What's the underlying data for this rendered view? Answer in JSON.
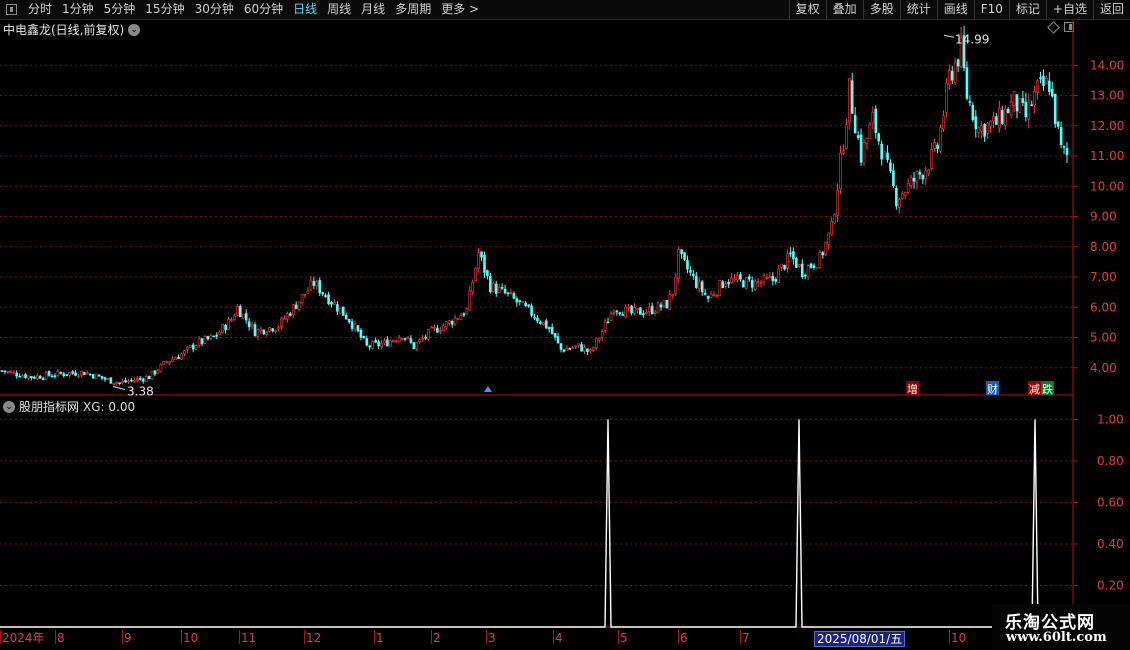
{
  "toolbar": {
    "left_items": [
      "分时",
      "1分钟",
      "5分钟",
      "15分钟",
      "30分钟",
      "60分钟",
      "日线",
      "周线",
      "月线",
      "多周期",
      "更多 >"
    ],
    "active": "日线",
    "right_items": [
      "复权",
      "叠加",
      "多股",
      "统计",
      "画线",
      "F10",
      "标记",
      "+自选",
      "返回"
    ]
  },
  "main": {
    "title": "中电鑫龙(日线,前复权)",
    "high_label": "14.99",
    "low_label": "3.38",
    "markers": [
      {
        "text": "增",
        "color": "#ffffff",
        "bg": "#8b0000"
      },
      {
        "text": "财",
        "color": "#ffffff",
        "bg": "#1e5aa8"
      },
      {
        "text": "减",
        "color": "#ffffff",
        "bg": "#a00000"
      },
      {
        "text": "跌",
        "color": "#ffffff",
        "bg": "#0a7a2a"
      }
    ]
  },
  "indicator": {
    "title": "股朋指标网",
    "value_label": "XG: 0.00"
  },
  "chart_data": [
    {
      "type": "candlestick",
      "title": "中电鑫龙(日线,前复权)",
      "y_ticks": [
        "14.00",
        "13.00",
        "12.00",
        "11.00",
        "10.00",
        "9.00",
        "8.00",
        "7.00",
        "6.00",
        "5.00",
        "4.00"
      ],
      "ylim": [
        3.1,
        15.0
      ],
      "high": 14.99,
      "low": 3.38,
      "close_path_anchors": [
        [
          0,
          3.9
        ],
        [
          10,
          3.7
        ],
        [
          20,
          3.8
        ],
        [
          28,
          3.85
        ],
        [
          36,
          3.6
        ],
        [
          40,
          3.5
        ],
        [
          50,
          3.7
        ],
        [
          56,
          4.2
        ],
        [
          62,
          4.5
        ],
        [
          66,
          4.8
        ],
        [
          72,
          5.0
        ],
        [
          78,
          5.6
        ],
        [
          80,
          6.0
        ],
        [
          86,
          5.2
        ],
        [
          94,
          5.4
        ],
        [
          100,
          6.1
        ],
        [
          106,
          6.8
        ],
        [
          110,
          6.4
        ],
        [
          118,
          5.6
        ],
        [
          124,
          4.7
        ],
        [
          130,
          4.8
        ],
        [
          136,
          5.1
        ],
        [
          140,
          4.7
        ],
        [
          146,
          5.2
        ],
        [
          152,
          5.5
        ],
        [
          158,
          5.9
        ],
        [
          162,
          7.8
        ],
        [
          166,
          6.7
        ],
        [
          172,
          6.4
        ],
        [
          180,
          5.8
        ],
        [
          186,
          5.3
        ],
        [
          190,
          4.6
        ],
        [
          196,
          4.7
        ],
        [
          200,
          4.5
        ],
        [
          204,
          5.2
        ],
        [
          208,
          6.0
        ],
        [
          214,
          5.8
        ],
        [
          220,
          5.9
        ],
        [
          226,
          6.1
        ],
        [
          228,
          6.5
        ],
        [
          230,
          7.7
        ],
        [
          236,
          6.8
        ],
        [
          240,
          6.3
        ],
        [
          246,
          6.9
        ],
        [
          256,
          6.8
        ],
        [
          262,
          6.9
        ],
        [
          268,
          7.7
        ],
        [
          272,
          7.2
        ],
        [
          278,
          7.6
        ],
        [
          282,
          8.6
        ],
        [
          286,
          11.5
        ],
        [
          288,
          13.2
        ],
        [
          292,
          11.0
        ],
        [
          296,
          12.2
        ],
        [
          300,
          10.9
        ],
        [
          304,
          9.6
        ],
        [
          310,
          10.2
        ],
        [
          314,
          10.6
        ],
        [
          318,
          11.3
        ],
        [
          322,
          13.6
        ],
        [
          326,
          14.5
        ],
        [
          328,
          13.0
        ],
        [
          332,
          11.9
        ],
        [
          338,
          12.1
        ],
        [
          344,
          12.8
        ],
        [
          348,
          12.3
        ],
        [
          352,
          13.2
        ],
        [
          356,
          13.4
        ],
        [
          360,
          11.2
        ],
        [
          362,
          11.0
        ]
      ],
      "x_labels": [
        "2024年",
        "8",
        "9",
        "10",
        "11",
        "12",
        "1",
        "2",
        "3",
        "4",
        "5",
        "6",
        "7",
        "2025/08/01/五",
        "10"
      ]
    },
    {
      "type": "line",
      "title": "股朋指标网",
      "series": [
        {
          "name": "XG",
          "values": [
            0,
            1,
            0,
            1,
            0,
            1,
            0
          ]
        }
      ],
      "y_ticks": [
        "1.00",
        "0.80",
        "0.60",
        "0.40",
        "0.20"
      ],
      "ylim": [
        0,
        1.05
      ],
      "signal_dates": [
        "4月下旬",
        "8月初",
        "10月下旬"
      ]
    }
  ]
}
